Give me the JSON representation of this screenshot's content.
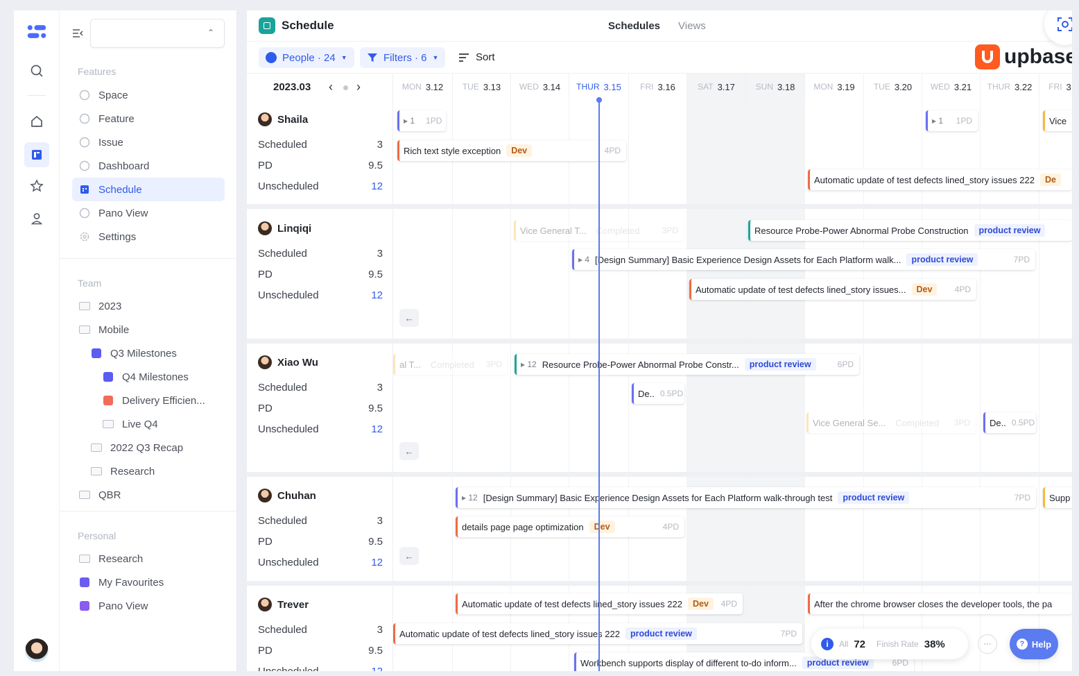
{
  "app": {
    "title": "Schedule",
    "tabs": [
      "Schedules",
      "Views"
    ],
    "brand": "upbase"
  },
  "toolbar": {
    "people": "People · 24",
    "filters": "Filters · 6",
    "sort": "Sort",
    "month": "2023.03"
  },
  "colors": {
    "accent": "#2f5bea",
    "dev_bar": "#f06a43",
    "review_bar": "#6b6ff2",
    "brand": "#ff5a1f"
  },
  "sidebar": {
    "features_label": "Features",
    "features": [
      {
        "label": "Space",
        "icon": "info-icon"
      },
      {
        "label": "Feature",
        "icon": "check-circle-icon"
      },
      {
        "label": "Issue",
        "icon": "alert-circle-icon"
      },
      {
        "label": "Dashboard",
        "icon": "clock-icon"
      },
      {
        "label": "Schedule",
        "icon": "calendar-icon",
        "active": true
      },
      {
        "label": "Pano View",
        "icon": "globe-icon"
      },
      {
        "label": "Settings",
        "icon": "gear-icon"
      }
    ],
    "team_label": "Team",
    "team": [
      {
        "label": "2023",
        "icon": "folder-icon"
      },
      {
        "label": "Mobile",
        "icon": "folder-icon"
      },
      {
        "label": "Q3 Milestones",
        "icon": "color-square-icon",
        "color": "#5b5cf0"
      },
      {
        "label": "Q4 Milestones",
        "icon": "color-square-icon",
        "color": "#5b5cf0"
      },
      {
        "label": "Delivery Efficien...",
        "icon": "color-square-icon",
        "color": "#f36b5a"
      },
      {
        "label": "Live Q4",
        "icon": "folder-icon"
      },
      {
        "label": "2022 Q3 Recap",
        "icon": "folder-icon"
      },
      {
        "label": "Research",
        "icon": "folder-icon"
      },
      {
        "label": "QBR",
        "icon": "folder-icon"
      }
    ],
    "personal_label": "Personal",
    "personal": [
      {
        "label": "Research",
        "icon": "folder-icon"
      },
      {
        "label": "My Favourites",
        "icon": "color-square-icon",
        "color": "#6b5cf0"
      },
      {
        "label": "Pano View",
        "icon": "color-square-icon",
        "color": "#8a5cf0"
      }
    ]
  },
  "days": [
    {
      "dow": "MON",
      "date": "3.12"
    },
    {
      "dow": "TUE",
      "date": "3.13"
    },
    {
      "dow": "WED",
      "date": "3.14"
    },
    {
      "dow": "THUR",
      "date": "3.15",
      "today": true
    },
    {
      "dow": "FRI",
      "date": "3.16"
    },
    {
      "dow": "SAT",
      "date": "3.17",
      "weekend": true
    },
    {
      "dow": "SUN",
      "date": "3.18",
      "weekend": true
    },
    {
      "dow": "MON",
      "date": "3.19"
    },
    {
      "dow": "TUE",
      "date": "3.20"
    },
    {
      "dow": "WED",
      "date": "3.21"
    },
    {
      "dow": "THUR",
      "date": "3.22"
    },
    {
      "dow": "FRI",
      "date": "3"
    }
  ],
  "people": [
    {
      "name": "Shaila",
      "scheduled": "3",
      "pd": "9.5",
      "unscheduled": "12"
    },
    {
      "name": "Linqiqi",
      "scheduled": "3",
      "pd": "9.5",
      "unscheduled": "12"
    },
    {
      "name": "Xiao Wu",
      "scheduled": "3",
      "pd": "9.5",
      "unscheduled": "12"
    },
    {
      "name": "Chuhan",
      "scheduled": "3",
      "pd": "9.5",
      "unscheduled": "12"
    },
    {
      "name": "Trever",
      "scheduled": "3",
      "pd": "9.5",
      "unscheduled": "12"
    }
  ],
  "labels": {
    "scheduled": "Scheduled",
    "pd": "PD",
    "unscheduled": "Unscheduled"
  },
  "tasks": [
    {
      "cls": "p",
      "cnt": "▸ 1",
      "title": "",
      "tag": "",
      "pd": "1PD"
    },
    {
      "cls": "p",
      "cnt": "▸ 1",
      "title": "",
      "tag": "",
      "pd": "1PD"
    },
    {
      "cls": "y",
      "cnt": "",
      "title": "Vice",
      "tag": "",
      "pd": ""
    },
    {
      "cls": "",
      "cnt": "",
      "title": "Rich text style exception",
      "tag": "Dev",
      "pd": "4PD"
    },
    {
      "cls": "",
      "cnt": "",
      "title": "Automatic update of test defects lined_story issues 222",
      "tag": "De",
      "pd": ""
    },
    {
      "cls": "y faded",
      "cnt": "",
      "title": "Vice General T...",
      "tag": "",
      "cmp": "Completed",
      "pd": "3PD"
    },
    {
      "cls": "teal",
      "cnt": "",
      "title": "Resource Probe-Power Abnormal Probe Construction",
      "tag": "product review",
      "pd": ""
    },
    {
      "cls": "p",
      "cnt": "▸ 4",
      "title": "[Design Summary] Basic Experience Design Assets for Each Platform walk...",
      "tag": "product review",
      "pd": "7PD"
    },
    {
      "cls": "",
      "cnt": "",
      "title": "Automatic update of test defects lined_story issues...",
      "tag": "Dev",
      "pd": "4PD"
    },
    {
      "cls": "y faded",
      "cnt": "",
      "title": "al T...",
      "tag": "",
      "cmp": "Completed",
      "pd": "3PD"
    },
    {
      "cls": "teal",
      "cnt": "▸ 12",
      "title": "Resource Probe-Power Abnormal Probe Constr...",
      "tag": "product review",
      "pd": "6PD"
    },
    {
      "cls": "p",
      "cnt": "",
      "title": "De..",
      "tag": "",
      "pd": "0.5PD"
    },
    {
      "cls": "y faded",
      "cnt": "",
      "title": "Vice General Se...",
      "tag": "",
      "cmp": "Completed",
      "pd": "3PD"
    },
    {
      "cls": "p",
      "cnt": "",
      "title": "De..",
      "tag": "",
      "pd": "0.5PD"
    },
    {
      "cls": "p",
      "cnt": "▸ 12",
      "title": "[Design Summary] Basic Experience Design Assets for Each Platform walk-through test",
      "tag": "product review",
      "pd": "7PD"
    },
    {
      "cls": "y",
      "cnt": "",
      "title": "Supp",
      "tag": "",
      "pd": ""
    },
    {
      "cls": "",
      "cnt": "",
      "title": "details page page optimization",
      "tag": "Dev",
      "pd": "4PD"
    },
    {
      "cls": "",
      "cnt": "",
      "title": "Automatic update of test defects lined_story issues 222",
      "tag": "Dev",
      "pd": "4PD"
    },
    {
      "cls": "",
      "cnt": "",
      "title": "After the chrome browser closes the developer tools, the pa",
      "tag": "",
      "pd": ""
    },
    {
      "cls": "",
      "cnt": "",
      "title": "Automatic update of test defects lined_story issues 222",
      "tag": "product review",
      "pd": "7PD"
    },
    {
      "cls": "p",
      "cnt": "",
      "title": "Workbench supports display of different to-do inform...",
      "tag": "product review",
      "pd": "6PD"
    }
  ],
  "stats": {
    "all_label": "All",
    "all": "72",
    "rate_label": "Finish Rate",
    "rate": "38%",
    "more": "···"
  },
  "help": "Help"
}
